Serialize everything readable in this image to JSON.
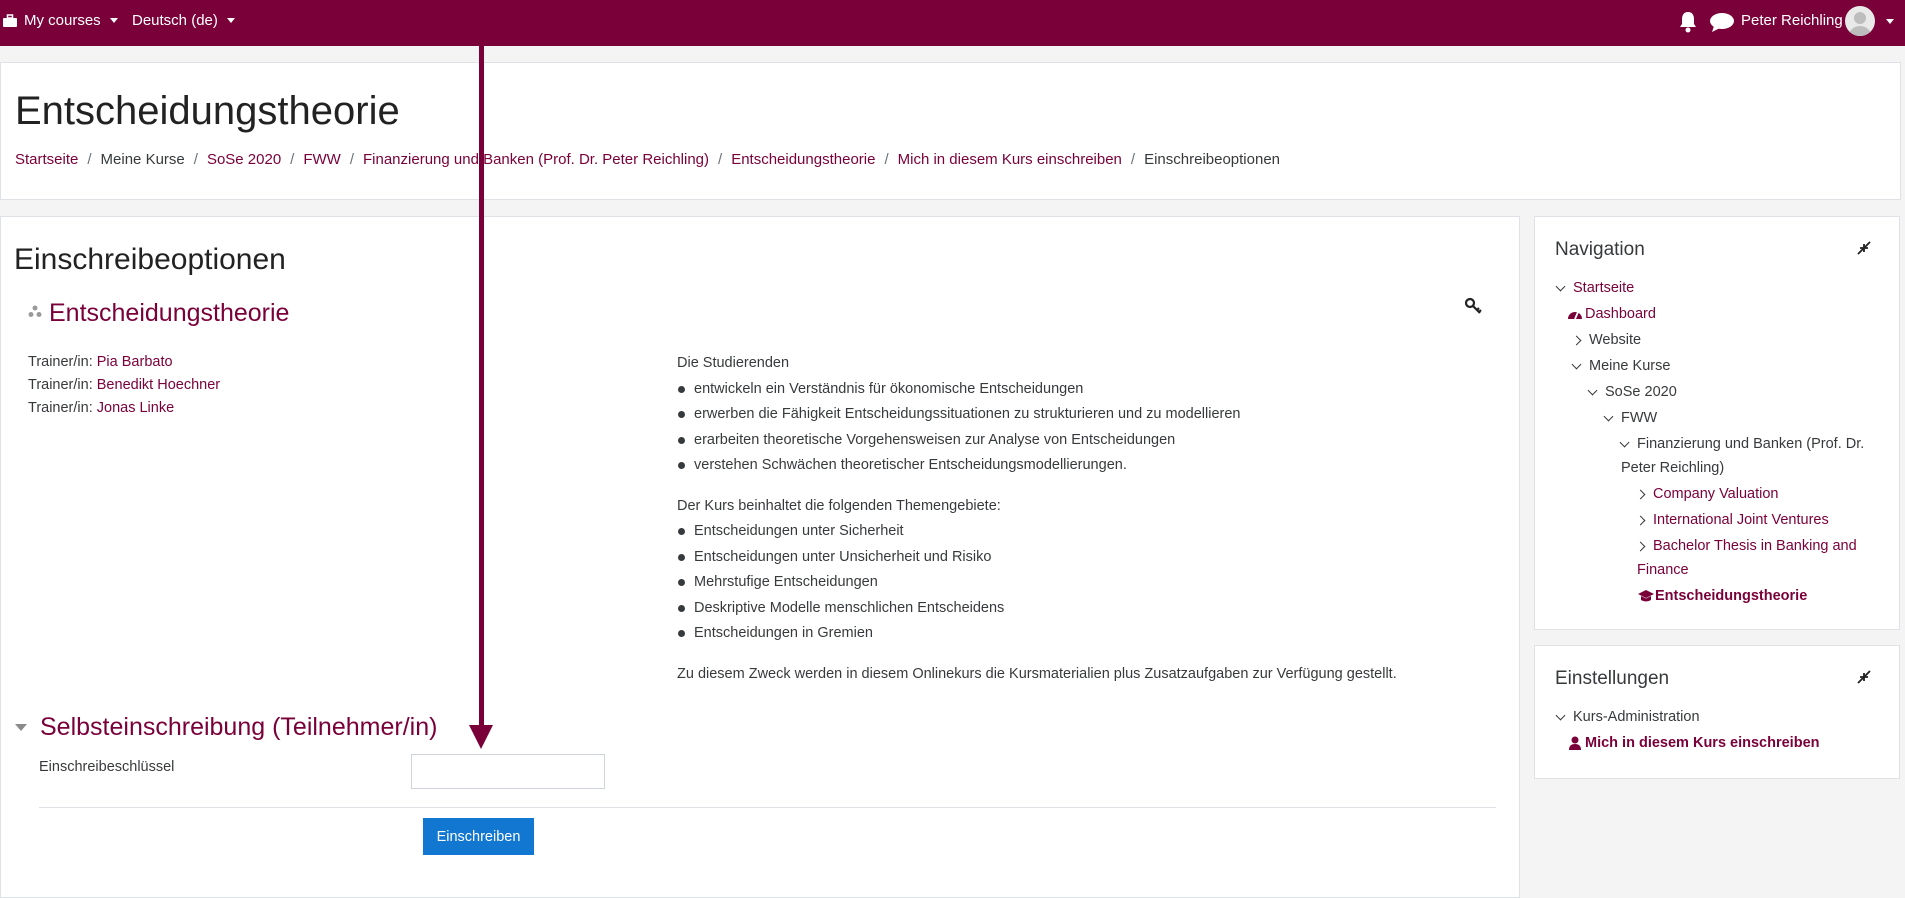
{
  "navbar": {
    "my_courses": "My courses",
    "language": "Deutsch (de)",
    "user_name": "Peter Reichling"
  },
  "header": {
    "title": "Entscheidungstheorie",
    "breadcrumb": [
      "Startseite",
      "Meine Kurse",
      "SoSe 2020",
      "FWW",
      "Finanzierung und Banken (Prof. Dr. Peter Reichling)",
      "Entscheidungstheorie",
      "Mich in diesem Kurs einschreiben",
      "Einschreibeoptionen"
    ]
  },
  "main": {
    "section_title": "Einschreibeoptionen",
    "course_title": "Entscheidungstheorie",
    "trainer_label": "Trainer/in:",
    "trainers": [
      "Pia Barbato",
      "Benedikt Hoechner",
      "Jonas Linke"
    ],
    "summary": {
      "intro": "Die Studierenden",
      "goals": [
        "entwickeln ein Verständnis für ökonomische Entscheidungen",
        "erwerben die Fähigkeit Entscheidungssituationen zu strukturieren und zu modellieren",
        "erarbeiten theoretische Vorgehensweisen zur Analyse von Entscheidungen",
        "verstehen Schwächen theoretischer Entscheidungsmodellierungen."
      ],
      "topics_intro": "Der Kurs beinhaltet die folgenden Themengebiete:",
      "topics": [
        "Entscheidungen unter Sicherheit",
        "Entscheidungen unter Unsicherheit und Risiko",
        "Mehrstufige Entscheidungen",
        "Deskriptive Modelle menschlichen Entscheidens",
        "Entscheidungen in Gremien"
      ],
      "closing": "Zu diesem Zweck werden in diesem Onlinekurs die Kursmaterialien plus Zusatzaufgaben zur Verfügung gestellt."
    },
    "self_enrol": {
      "title": "Selbsteinschreibung (Teilnehmer/in)",
      "key_label": "Einschreibeschlüssel",
      "key_value": "",
      "submit": "Einschreiben"
    }
  },
  "nav_block": {
    "title": "Navigation",
    "items": {
      "startseite": "Startseite",
      "dashboard": "Dashboard",
      "website": "Website",
      "meine_kurse": "Meine Kurse",
      "sose": "SoSe 2020",
      "fww": "FWW",
      "finanzierung_line1": "Finanzierung und Banken (Prof. Dr.",
      "finanzierung_line2": "Peter Reichling)",
      "company_valuation": "Company Valuation",
      "international_jv": "International Joint Ventures",
      "bachelor_line1": "Bachelor Thesis in Banking and",
      "bachelor_line2": "Finance",
      "current_course": "Entscheidungstheorie"
    }
  },
  "settings_block": {
    "title": "Einstellungen",
    "admin": "Kurs-Administration",
    "enrol_me": "Mich in diesem Kurs einschreiben"
  },
  "colors": {
    "brand": "#7a0039",
    "button": "#1177d1"
  }
}
